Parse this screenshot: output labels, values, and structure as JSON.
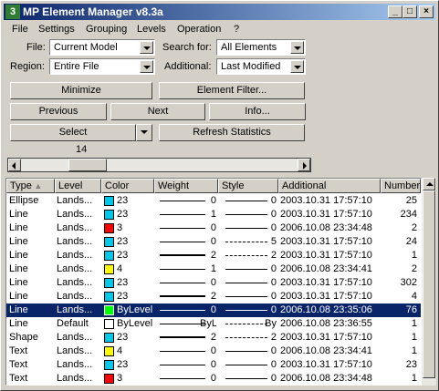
{
  "window": {
    "title": "MP Element Manager   v8.3a",
    "app_icon": "gear-icon",
    "controls": {
      "minimize": "_",
      "maximize": "□",
      "close": "×"
    }
  },
  "menu": [
    "File",
    "Settings",
    "Grouping",
    "Levels",
    "Operation",
    "?"
  ],
  "filters": {
    "file_label": "File:",
    "file_value": "Current Model",
    "search_label": "Search for:",
    "search_value": "All Elements",
    "region_label": "Region:",
    "region_value": "Entire File",
    "additional_label": "Additional:",
    "additional_value": "Last Modified"
  },
  "buttons": {
    "minimize": "Minimize",
    "element_filter": "Element Filter...",
    "previous": "Previous",
    "next": "Next",
    "info": "Info...",
    "select": "Select",
    "refresh": "Refresh Statistics"
  },
  "count": "14",
  "scroll_position": 0.2,
  "columns": [
    "Type",
    "Level",
    "Color",
    "Weight",
    "Style",
    "Additional",
    "Number"
  ],
  "rows": [
    {
      "type": "Ellipse",
      "level": "Lands...",
      "color": "23",
      "swatch": "#00c8e8",
      "weight": "0",
      "wt": 1,
      "style": "0",
      "dash": "solid",
      "additional": "2003.10.31 17:57:10",
      "number": "25",
      "sel": false
    },
    {
      "type": "Line",
      "level": "Lands...",
      "color": "23",
      "swatch": "#00c8e8",
      "weight": "1",
      "wt": 1,
      "style": "0",
      "dash": "solid",
      "additional": "2003.10.31 17:57:10",
      "number": "234",
      "sel": false
    },
    {
      "type": "Line",
      "level": "Lands...",
      "color": "3",
      "swatch": "#ff0000",
      "weight": "0",
      "wt": 1,
      "style": "0",
      "dash": "solid",
      "additional": "2006.10.08 23:34:48",
      "number": "2",
      "sel": false
    },
    {
      "type": "Line",
      "level": "Lands...",
      "color": "23",
      "swatch": "#00c8e8",
      "weight": "0",
      "wt": 1,
      "style": "5",
      "dash": "dashed",
      "additional": "2003.10.31 17:57:10",
      "number": "24",
      "sel": false
    },
    {
      "type": "Line",
      "level": "Lands...",
      "color": "23",
      "swatch": "#00c8e8",
      "weight": "2",
      "wt": 2,
      "style": "2",
      "dash": "dashed",
      "additional": "2003.10.31 17:57:10",
      "number": "1",
      "sel": false
    },
    {
      "type": "Line",
      "level": "Lands...",
      "color": "4",
      "swatch": "#ffff00",
      "weight": "1",
      "wt": 1,
      "style": "0",
      "dash": "solid",
      "additional": "2006.10.08 23:34:41",
      "number": "2",
      "sel": false
    },
    {
      "type": "Line",
      "level": "Lands...",
      "color": "23",
      "swatch": "#00c8e8",
      "weight": "0",
      "wt": 1,
      "style": "0",
      "dash": "solid",
      "additional": "2003.10.31 17:57:10",
      "number": "302",
      "sel": false
    },
    {
      "type": "Line",
      "level": "Lands...",
      "color": "23",
      "swatch": "#00c8e8",
      "weight": "2",
      "wt": 2,
      "style": "0",
      "dash": "solid",
      "additional": "2003.10.31 17:57:10",
      "number": "4",
      "sel": false
    },
    {
      "type": "Line",
      "level": "Lands...",
      "color": "ByLevel",
      "swatch": "#00ff00",
      "weight": "0",
      "wt": 1,
      "style": "0",
      "dash": "solid",
      "additional": "2006.10.08 23:35:06",
      "number": "76",
      "sel": true
    },
    {
      "type": "Line",
      "level": "Default",
      "color": "ByLevel",
      "swatch": "#ffffff",
      "weight": "ByL",
      "wt": 1,
      "style": "By",
      "dash": "dashed",
      "additional": "2006.10.08 23:36:55",
      "number": "1",
      "sel": false
    },
    {
      "type": "Shape",
      "level": "Lands...",
      "color": "23",
      "swatch": "#00c8e8",
      "weight": "2",
      "wt": 2,
      "style": "2",
      "dash": "dashed",
      "additional": "2003.10.31 17:57:10",
      "number": "1",
      "sel": false
    },
    {
      "type": "Text",
      "level": "Lands...",
      "color": "4",
      "swatch": "#ffff00",
      "weight": "0",
      "wt": 1,
      "style": "0",
      "dash": "solid",
      "additional": "2006.10.08 23:34:41",
      "number": "1",
      "sel": false
    },
    {
      "type": "Text",
      "level": "Lands...",
      "color": "23",
      "swatch": "#00c8e8",
      "weight": "0",
      "wt": 1,
      "style": "0",
      "dash": "solid",
      "additional": "2003.10.31 17:57:10",
      "number": "23",
      "sel": false
    },
    {
      "type": "Text",
      "level": "Lands...",
      "color": "3",
      "swatch": "#ff0000",
      "weight": "0",
      "wt": 1,
      "style": "0",
      "dash": "solid",
      "additional": "2006.10.08 23:34:48",
      "number": "1",
      "sel": false
    }
  ]
}
